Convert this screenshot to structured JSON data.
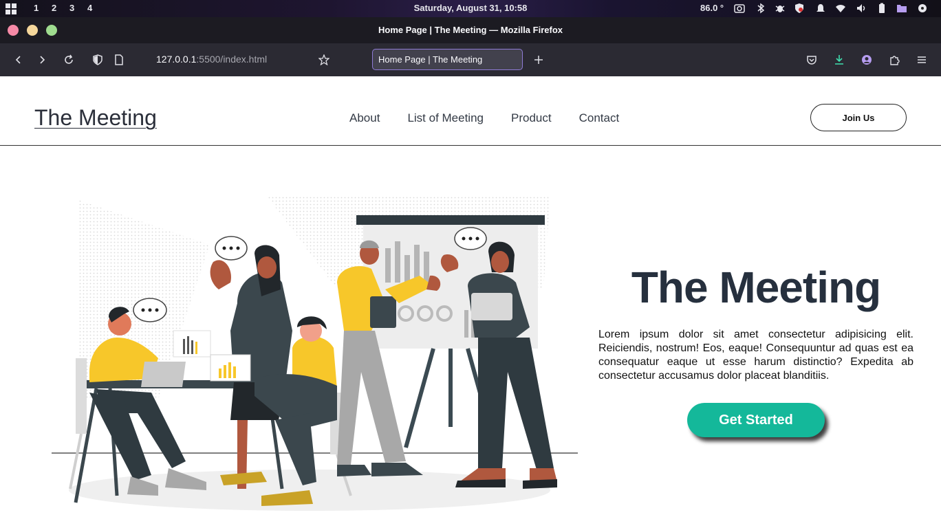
{
  "os": {
    "workspaces": [
      "1",
      "2",
      "3",
      "4"
    ],
    "clock": "Saturday, August 31, 10:58",
    "temperature": "86.0 °"
  },
  "window": {
    "title": "Home Page | The Meeting — Mozilla Firefox"
  },
  "browser": {
    "url_host": "127.0.0.1",
    "url_path": ":5500/index.html",
    "tab_title": "Home Page | The Meeting"
  },
  "site": {
    "logo": "The Meeting",
    "nav": [
      "About",
      "List of Meeting",
      "Product",
      "Contact"
    ],
    "join_label": "Join Us",
    "hero_title": "The Meeting",
    "hero_text": "Lorem ipsum dolor sit amet consectetur adipisicing elit. Reiciendis, nostrum! Eos, eaque! Consequuntur ad quas est ea consequatur eaque ut esse harum distinctio? Expedita ab consectetur accusamus dolor placeat blanditiis.",
    "cta_label": "Get Started"
  },
  "colors": {
    "accent": "#14b89a",
    "heading": "#26303e",
    "illustration_yellow": "#f7c72a",
    "illustration_dark": "#2f3a40"
  }
}
